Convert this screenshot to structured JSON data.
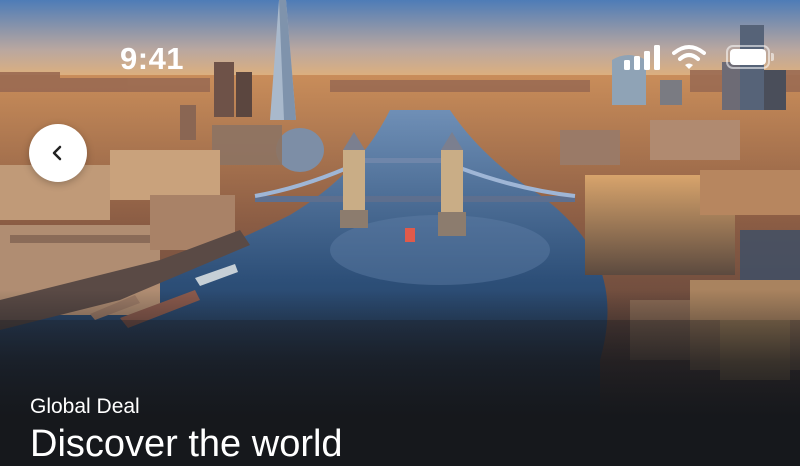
{
  "status_bar": {
    "time": "9:41",
    "signal_icon": "cellular-signal-icon",
    "wifi_icon": "wifi-icon",
    "battery_icon": "battery-icon",
    "battery_level": 1.0
  },
  "navigation": {
    "back_icon": "chevron-left-icon"
  },
  "hero": {
    "image": "aerial-city-river-bridge-photo"
  },
  "deal": {
    "label": "Global Deal",
    "title": "Discover the world"
  },
  "colors": {
    "sky_top": "#4e7cb7",
    "sky_horizon": "#f0b46b",
    "river": "#2d4f78",
    "bottom_panel": "#16181c",
    "text": "#ffffff"
  }
}
